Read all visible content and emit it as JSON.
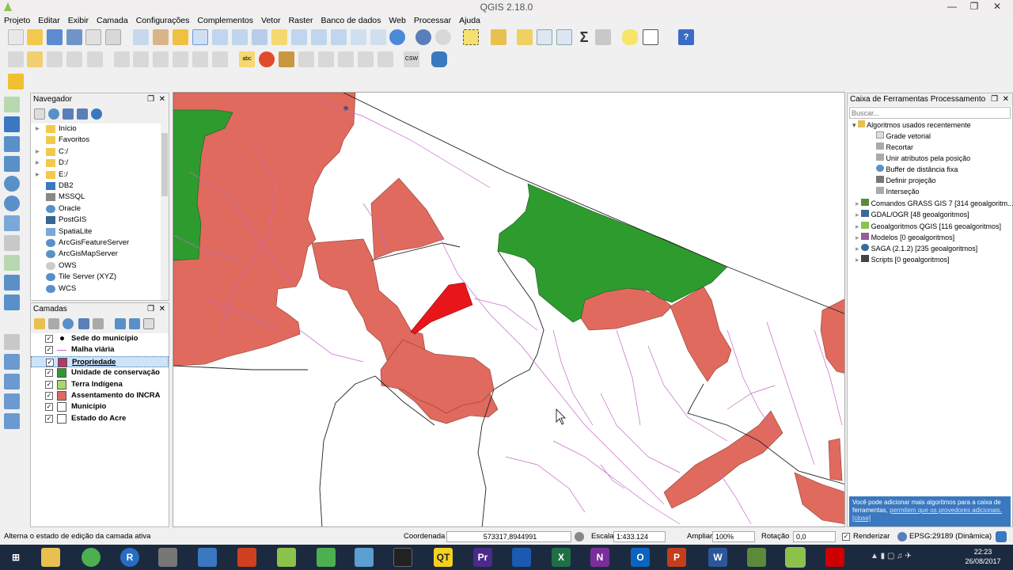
{
  "window": {
    "title": "QGIS 2.18.0"
  },
  "menu": [
    "Projeto",
    "Editar",
    "Exibir",
    "Camada",
    "Configurações",
    "Complementos",
    "Vetor",
    "Raster",
    "Banco de dados",
    "Web",
    "Processar",
    "Ajuda"
  ],
  "browser": {
    "title": "Navegador",
    "items": [
      "Início",
      "Favoritos",
      "C:/",
      "D:/",
      "E:/",
      "DB2",
      "MSSQL",
      "Oracle",
      "PostGIS",
      "SpatiaLite",
      "ArcGisFeatureServer",
      "ArcGisMapServer",
      "OWS",
      "Tile Server (XYZ)",
      "WCS"
    ]
  },
  "layers": {
    "title": "Camadas",
    "items": [
      {
        "name": "Sede do município",
        "color": "#000000",
        "kind": "point"
      },
      {
        "name": "Malha viária",
        "color": "#c86ac8",
        "kind": "line"
      },
      {
        "name": "Propriedade",
        "color": "#b03a6a",
        "kind": "fill"
      },
      {
        "name": "Unidade de conservação",
        "color": "#2e9b2e",
        "kind": "fill"
      },
      {
        "name": "Terra Indígena",
        "color": "#a8d86a",
        "kind": "fill"
      },
      {
        "name": "Assentamento do INCRA",
        "color": "#e06a5e",
        "kind": "fill"
      },
      {
        "name": "Município",
        "color": "#ffffff",
        "kind": "fill"
      },
      {
        "name": "Estado do Acre",
        "color": "#ffffff",
        "kind": "fill"
      }
    ]
  },
  "processing": {
    "title": "Caixa de Ferramentas Processamento",
    "search_placeholder": "Buscar...",
    "recent_header": "Algoritmos usados recentemente",
    "recent": [
      "Grade vetorial",
      "Recortar",
      "Unir atributos pela posição",
      "Buffer de distância fixa",
      "Definir projeção",
      "Interseção"
    ],
    "groups": [
      "Comandos GRASS GIS 7 [314 geoalgoritm...",
      "GDAL/OGR [48 geoalgoritmos]",
      "Geoalgoritmos QGIS [116 geoalgoritmos]",
      "Modelos [0 geoalgoritmos]",
      "SAGA (2.1.2) [235 geoalgoritmos]",
      "Scripts [0 geoalgoritmos]"
    ],
    "notice_text": "Você pode adicionar mais algoritmos para a caixa de ferramentas,",
    "notice_link1": "permitem que os provedores adicionais.",
    "notice_link2": "[close]"
  },
  "status": {
    "message": "Alterna o estado de edição da camada ativa",
    "coord_label": "Coordenada",
    "coord_value": "573317,8944991",
    "scale_label": "Escala",
    "scale_value": "1:433.124",
    "zoom_label": "Ampliar",
    "zoom_value": "100%",
    "rotation_label": "Rotação",
    "rotation_value": "0,0",
    "render_label": "Renderizar",
    "crs": "EPSG:29189 (Dinâmica)"
  },
  "clock": {
    "time": "22:23",
    "date": "26/08/2017"
  },
  "colors": {
    "assentamento": "#e06a5e",
    "conservacao": "#2e9b2e",
    "propriedade": "#e8161b",
    "roads": "#c86ac8"
  }
}
